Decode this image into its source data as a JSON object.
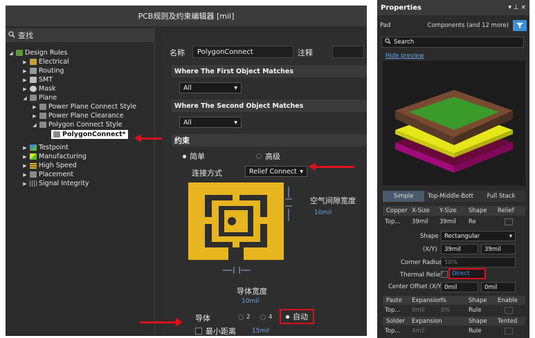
{
  "rules_window": {
    "title": "PCB规则及约束编辑器 [mil]",
    "search_label": "查找",
    "tree": [
      {
        "label": "Design Rules"
      },
      {
        "label": "Electrical"
      },
      {
        "label": "Routing"
      },
      {
        "label": "SMT"
      },
      {
        "label": "Mask"
      },
      {
        "label": "Plane"
      },
      {
        "label": "Power Plane Connect Style"
      },
      {
        "label": "Power Plane Clearance"
      },
      {
        "label": "Polygon Connect Style"
      },
      {
        "label": "PolygonConnect*"
      },
      {
        "label": "Testpoint"
      },
      {
        "label": "Manufacturing"
      },
      {
        "label": "High Speed"
      },
      {
        "label": "Placement"
      },
      {
        "label": "Signal Integrity"
      }
    ],
    "name_label": "名称",
    "name_value": "PolygonConnect",
    "comment_label": "注释",
    "first_match_header": "Where The First Object Matches",
    "first_match_value": "All",
    "second_match_header": "Where The Second Object Matches",
    "second_match_value": "All",
    "constraints_header": "约束",
    "mode_simple": "简单",
    "mode_advanced": "高级",
    "connect_style_label": "连接方式",
    "connect_style_value": "Relief Connect",
    "air_gap_label": "空气间隙宽度",
    "air_gap_value": "10mil",
    "conductor_width_label": "导体宽度",
    "conductor_width_value": "10mil",
    "conductors_label": "导体",
    "conductor_opt_2": "2",
    "conductor_opt_4": "4",
    "conductor_opt_auto": "自动",
    "min_distance_label": "最小距离",
    "min_distance_value": "15mil"
  },
  "properties": {
    "title": "Properties",
    "pin_glyphs": "▾ ⊥ ×",
    "object_type": "Pad",
    "filter_text": "Components (and 12 more)",
    "search_placeholder": "Search",
    "hide_preview": "Hide preview",
    "tabs": [
      "Simple",
      "Top-Middle-Bott",
      "Full Stack"
    ],
    "table_headers": [
      "Copper",
      "X-Size",
      "Y-Size",
      "Shape",
      "Relief"
    ],
    "table_row": {
      "layer": "Top...",
      "x": "39mil",
      "y": "39mil",
      "shape": "Re"
    },
    "shape_label": "Shape",
    "shape_value": "Rectangular",
    "xy_label": "(X/Y)",
    "x_value": "39mil",
    "y_value": "39mil",
    "corner_radius_label": "Corner Radius",
    "corner_radius_value": "50%",
    "thermal_relief_label": "Thermal Relief",
    "thermal_relief_value": "Direct",
    "offset_label": "Center Offset (X/Y)",
    "offset_x": "0mil",
    "offset_y": "0mil",
    "paste_headers": [
      "Paste",
      "Expansion",
      "%",
      "Shape",
      "Enable"
    ],
    "paste_row": {
      "layer": "Top...",
      "expansion": "0mil",
      "pct": "0%",
      "shape": "Rule"
    },
    "solder_headers": [
      "Solder",
      "Expansion",
      "Shape",
      "Tented"
    ],
    "solder_row": {
      "layer": "Top...",
      "expansion": "4mil",
      "shape": "Rule"
    }
  },
  "colors": {
    "accent_red": "#e0101a",
    "relief_gold": "#e6b520",
    "link_blue": "#6aa8e8",
    "filter_blue": "#3a8fd8",
    "layer_green": "#3a9a2a",
    "layer_yellow": "#e6e61a",
    "layer_magenta": "#b0107a"
  }
}
